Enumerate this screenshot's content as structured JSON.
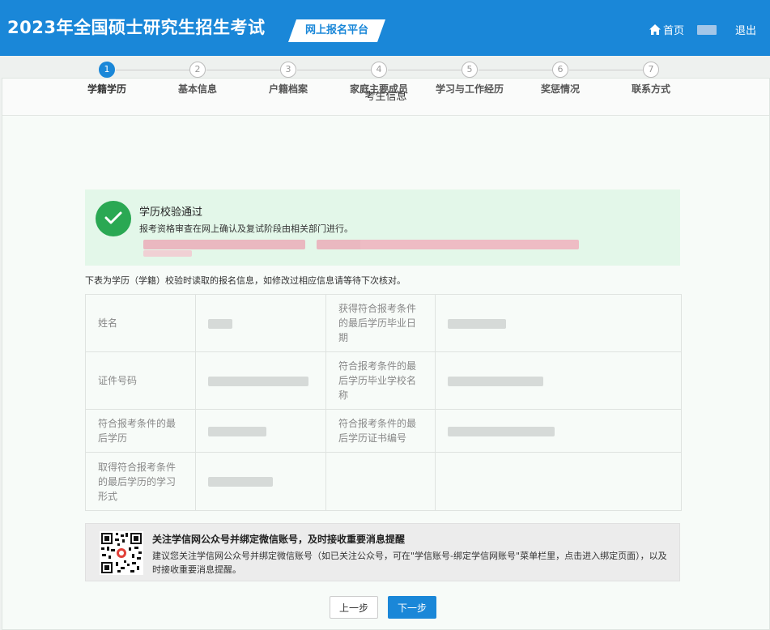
{
  "header": {
    "title": "2023年全国硕士研究生招生考试",
    "platform": "网上报名平台",
    "home_label": "首页",
    "logout_label": "退出",
    "home_icon": "home-icon"
  },
  "panel": {
    "title": "考生信息"
  },
  "steps": [
    {
      "num": "1",
      "label": "学籍学历",
      "active": true
    },
    {
      "num": "2",
      "label": "基本信息",
      "active": false
    },
    {
      "num": "3",
      "label": "户籍档案",
      "active": false
    },
    {
      "num": "4",
      "label": "家庭主要成员",
      "active": false
    },
    {
      "num": "5",
      "label": "学习与工作经历",
      "active": false
    },
    {
      "num": "6",
      "label": "奖惩情况",
      "active": false
    },
    {
      "num": "7",
      "label": "联系方式",
      "active": false
    }
  ],
  "success": {
    "title": "学历校验通过",
    "sub": "报考资格审查在网上确认及复试阶段由相关部门进行。",
    "icon": "check-circle-icon"
  },
  "note": "下表为学历（学籍）校验时读取的报名信息，如修改过相应信息请等待下次核对。",
  "table": {
    "r1_l1": "姓名",
    "r1_l2": "获得符合报考条件的最后学历毕业日期",
    "r2_l1": "证件号码",
    "r2_l2": "符合报考条件的最后学历毕业学校名称",
    "r3_l1": "符合报考条件的最后学历",
    "r3_l2": "符合报考条件的最后学历证书编号",
    "r4_l1": "取得符合报考条件的最后学历的学习形式"
  },
  "wechat": {
    "title": "关注学信网公众号并绑定微信账号，及时接收重要消息提醒",
    "desc": "建议您关注学信网公众号并绑定微信账号（如已关注公众号，可在\"学信账号-绑定学信网账号\"菜单栏里，点击进入绑定页面），以及时接收重要消息提醒。",
    "icon": "qr-code-icon"
  },
  "buttons": {
    "prev": "上一步",
    "next": "下一步"
  },
  "colors": {
    "primary": "#1a87d8",
    "success": "#2aa853",
    "success_bg": "#e3f7e9"
  }
}
